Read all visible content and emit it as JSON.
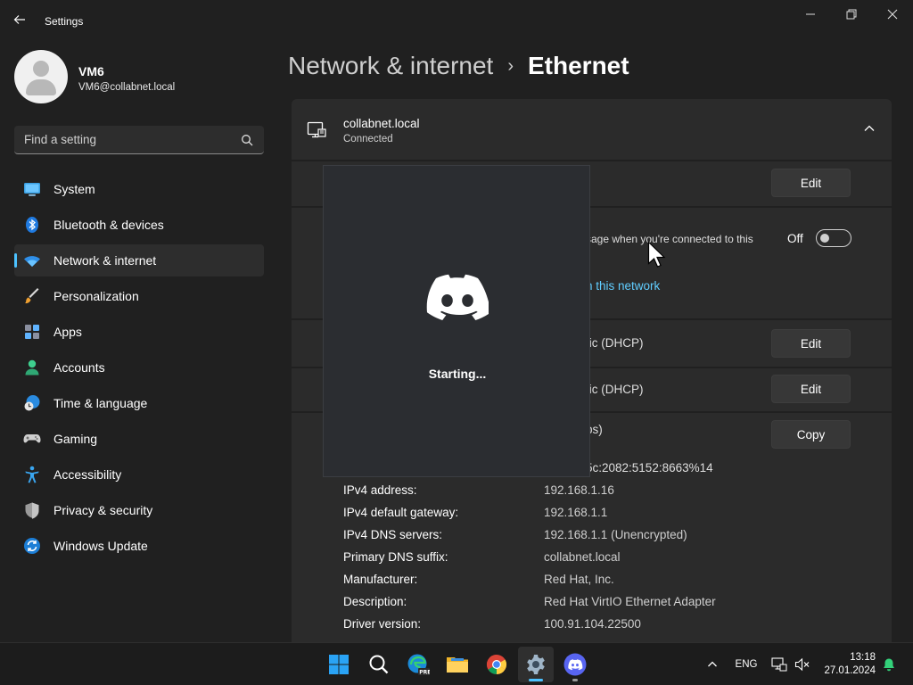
{
  "window": {
    "title": "Settings"
  },
  "user": {
    "name": "VM6",
    "email": "VM6@collabnet.local"
  },
  "search": {
    "placeholder": "Find a setting"
  },
  "sidebar": {
    "items": [
      {
        "label": "System",
        "icon": "system-icon",
        "active": false
      },
      {
        "label": "Bluetooth & devices",
        "icon": "bluetooth-icon",
        "active": false
      },
      {
        "label": "Network & internet",
        "icon": "wifi-icon",
        "active": true
      },
      {
        "label": "Personalization",
        "icon": "brush-icon",
        "active": false
      },
      {
        "label": "Apps",
        "icon": "apps-icon",
        "active": false
      },
      {
        "label": "Accounts",
        "icon": "accounts-icon",
        "active": false
      },
      {
        "label": "Time & language",
        "icon": "globe-clock-icon",
        "active": false
      },
      {
        "label": "Gaming",
        "icon": "gamepad-icon",
        "active": false
      },
      {
        "label": "Accessibility",
        "icon": "accessibility-icon",
        "active": false
      },
      {
        "label": "Privacy & security",
        "icon": "shield-icon",
        "active": false
      },
      {
        "label": "Windows Update",
        "icon": "update-icon",
        "active": false
      }
    ]
  },
  "breadcrumb": {
    "parent": "Network & internet",
    "separator": "›",
    "current": "Ethernet"
  },
  "network": {
    "name": "collabnet.local",
    "status": "Connected"
  },
  "rows": {
    "auth_edit": "Edit",
    "metered_text": "sage when you're connected to this",
    "metered_state": "Off",
    "data_limit_link": "n this network",
    "ip_assignment_value": "tic (DHCP)",
    "ip_assignment_edit": "Edit",
    "dns_assignment_value": "tic (DHCP)",
    "dns_assignment_edit": "Edit",
    "link_speed_value": "ps)",
    "copy_button": "Copy",
    "ipv6_partial": "5c:2082:5152:8663%14"
  },
  "properties": [
    {
      "label": "IPv4 address:",
      "value": "192.168.1.16"
    },
    {
      "label": "IPv4 default gateway:",
      "value": "192.168.1.1"
    },
    {
      "label": "IPv4 DNS servers:",
      "value": "192.168.1.1 (Unencrypted)"
    },
    {
      "label": "Primary DNS suffix:",
      "value": "collabnet.local"
    },
    {
      "label": "Manufacturer:",
      "value": "Red Hat, Inc."
    },
    {
      "label": "Description:",
      "value": "Red Hat VirtIO Ethernet Adapter"
    },
    {
      "label": "Driver version:",
      "value": "100.91.104.22500"
    }
  ],
  "discord": {
    "status": "Starting..."
  },
  "taskbar": {
    "language": "ENG",
    "time": "13:18",
    "date": "27.01.2024"
  },
  "colors": {
    "accent": "#4cc2ff",
    "link": "#60cdff",
    "discord_blurple": "#5865f2"
  }
}
